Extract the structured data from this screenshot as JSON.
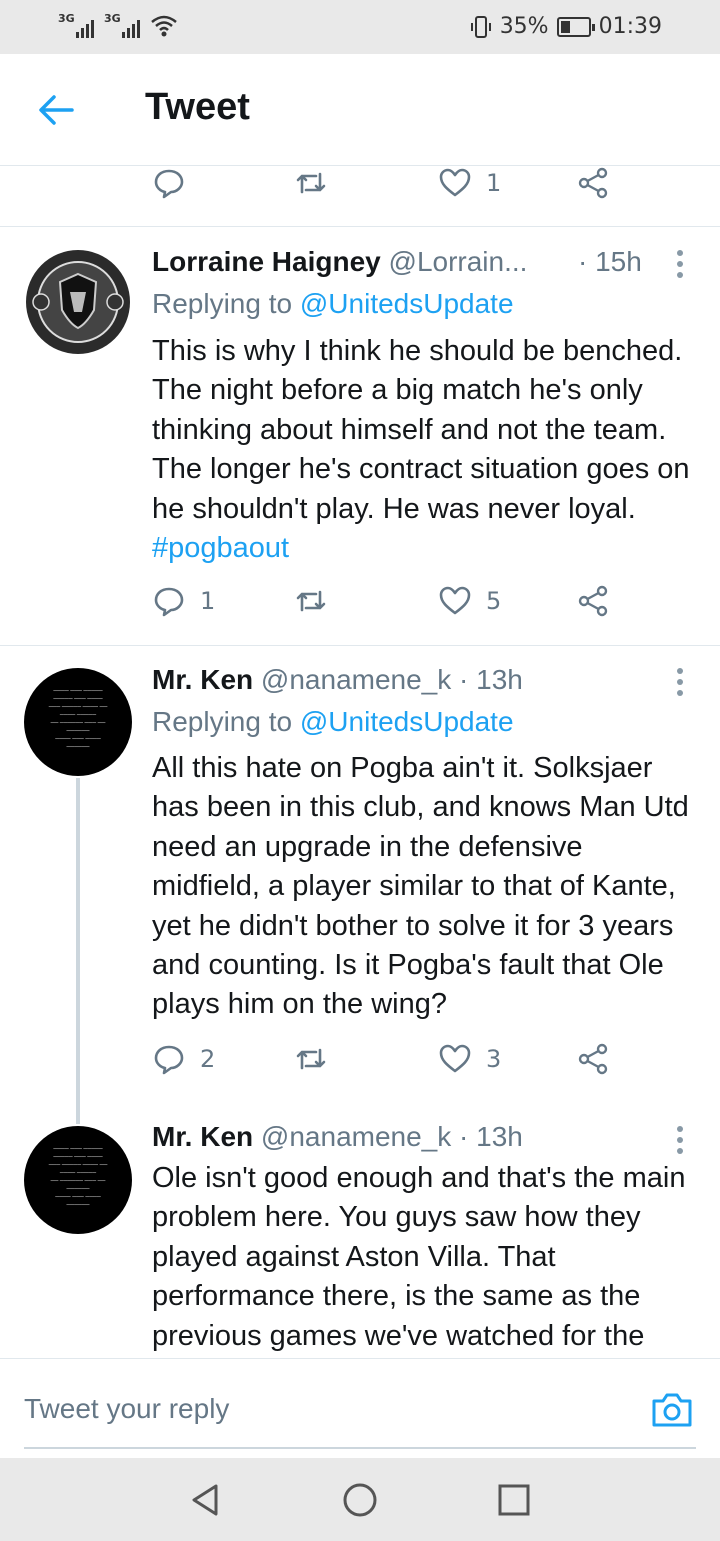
{
  "status_bar": {
    "signal1": "3G",
    "signal2": "3G",
    "battery": "35%",
    "battery_level": 0.35,
    "time": "01:39"
  },
  "header": {
    "title": "Tweet"
  },
  "top_actions": {
    "like_count": "1"
  },
  "tweets": [
    {
      "name": "Lorraine Haigney",
      "handle": "@Lorrain...",
      "time": "· 15h",
      "replying_prefix": "Replying to ",
      "replying_to": "@UnitedsUpdate",
      "body": "This is why I think he should be benched. The night before a big match he's only thinking about himself and not the team. The longer he's contract situation goes on he shouldn't play. He was never loyal. ",
      "hashtag": "#pogbaout",
      "reply_count": "1",
      "like_count": "5"
    },
    {
      "name": "Mr. Ken",
      "handle": "@nanamene_k",
      "time": "· 13h",
      "replying_prefix": "Replying to ",
      "replying_to": "@UnitedsUpdate",
      "body": "All this hate on Pogba ain't it. Solksjaer has been in this club, and knows Man Utd need an upgrade in the defensive midfield, a player similar to that of Kante, yet he didn't bother to solve it for 3 years and counting. Is it Pogba's fault that Ole plays him on the wing?",
      "reply_count": "2",
      "like_count": "3"
    },
    {
      "name": "Mr. Ken",
      "handle": "@nanamene_k",
      "time": "· 13h",
      "body": "Ole isn't good enough and that's the main problem here. You guys saw how they played against Aston Villa. That performance there, is the same as the previous games we've watched for the"
    }
  ],
  "reply_bar": {
    "placeholder": "Tweet your reply"
  },
  "colors": {
    "accent": "#1da1f2",
    "muted": "#657786",
    "text": "#14171a"
  }
}
